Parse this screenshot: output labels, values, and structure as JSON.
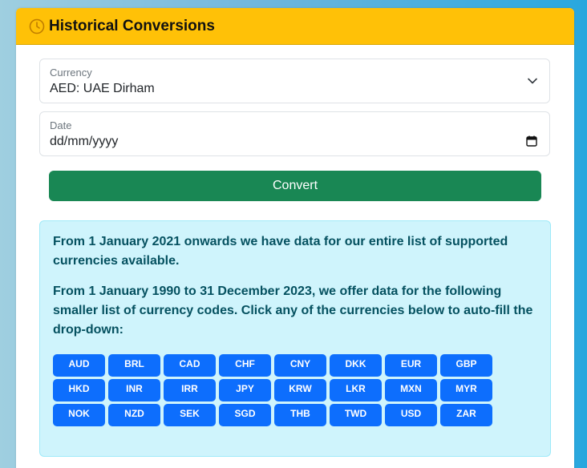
{
  "header": {
    "title": "Historical Conversions",
    "icon": "clock-icon"
  },
  "currency_field": {
    "label": "Currency",
    "value": "AED: UAE Dirham"
  },
  "date_field": {
    "label": "Date",
    "placeholder": "dd/mm/yyyy"
  },
  "convert_button": {
    "label": "Convert"
  },
  "info": {
    "para1": "From 1 January 2021 onwards we have data for our entire list of supported currencies available.",
    "para2": "From 1 January 1990 to 31 December 2023, we offer data for the following smaller list of currency codes. Click any of the currencies below to auto-fill the drop-down:"
  },
  "currencies": [
    "AUD",
    "BRL",
    "CAD",
    "CHF",
    "CNY",
    "DKK",
    "EUR",
    "GBP",
    "HKD",
    "INR",
    "IRR",
    "JPY",
    "KRW",
    "LKR",
    "MXN",
    "MYR",
    "NOK",
    "NZD",
    "SEK",
    "SGD",
    "THB",
    "TWD",
    "USD",
    "ZAR"
  ],
  "colors": {
    "header_bg": "#ffc107",
    "convert_bg": "#198754",
    "currency_btn_bg": "#0d6efd",
    "info_bg": "#cff4fc",
    "info_text": "#055160"
  }
}
